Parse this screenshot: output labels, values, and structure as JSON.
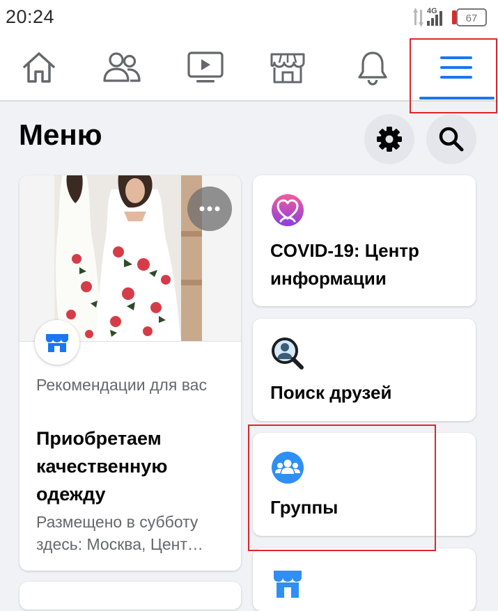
{
  "status_bar": {
    "time": "20:24",
    "network_type": "4G",
    "battery_level": "67"
  },
  "nav": {
    "tabs": [
      {
        "id": "home",
        "icon": "home-icon"
      },
      {
        "id": "friends",
        "icon": "friends-icon"
      },
      {
        "id": "watch",
        "icon": "video-play-icon"
      },
      {
        "id": "marketplace",
        "icon": "marketplace-store-icon"
      },
      {
        "id": "notifications",
        "icon": "bell-icon"
      },
      {
        "id": "menu",
        "icon": "hamburger-menu-icon",
        "active": true
      }
    ]
  },
  "header": {
    "title": "Меню",
    "settings_icon": "gear-icon",
    "search_icon": "search-icon"
  },
  "recommendation": {
    "label": "Рекомендации для вас",
    "title": "Приобретаем качественную одежду",
    "posted": "Размещено в субботу здесь: Москва, Цент…",
    "more_icon": "more-dots-icon",
    "badge_icon": "marketplace-store-icon"
  },
  "shortcuts": [
    {
      "label": "COVID-19: Центр информации",
      "icon": "covid-heart-icon"
    },
    {
      "label": "Поиск друзей",
      "icon": "find-friends-icon"
    },
    {
      "label": "Группы",
      "icon": "groups-icon"
    },
    {
      "label": "",
      "icon": "marketplace-store-icon"
    }
  ],
  "colors": {
    "accent": "#1877f2",
    "background": "#f0f2f5",
    "highlight_box": "#e0242b",
    "text_primary": "#050505",
    "text_secondary": "#65676b"
  }
}
